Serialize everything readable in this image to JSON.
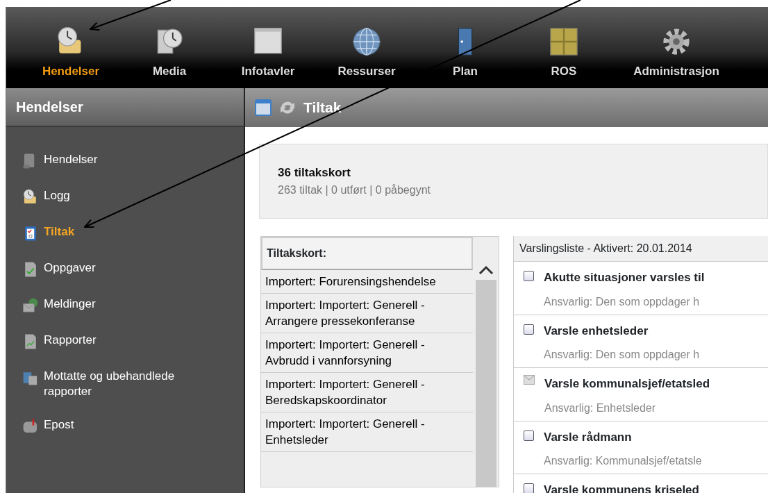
{
  "top_nav": [
    {
      "label": "Hendelser",
      "selected": true
    },
    {
      "label": "Media",
      "selected": false
    },
    {
      "label": "Infotavler",
      "selected": false
    },
    {
      "label": "Ressurser",
      "selected": false
    },
    {
      "label": "Plan",
      "selected": false
    },
    {
      "label": "ROS",
      "selected": false
    },
    {
      "label": "Administrasjon",
      "selected": false
    }
  ],
  "sidebar": {
    "title": "Hendelser",
    "items": [
      {
        "label": "Hendelser",
        "selected": false
      },
      {
        "label": "Logg",
        "selected": false
      },
      {
        "label": "Tiltak",
        "selected": true
      },
      {
        "label": "Oppgaver",
        "selected": false
      },
      {
        "label": "Meldinger",
        "selected": false
      },
      {
        "label": "Rapporter",
        "selected": false
      },
      {
        "label": "Mottatte og ubehandlede rapporter",
        "selected": false
      },
      {
        "label": "Epost",
        "selected": false
      }
    ]
  },
  "content": {
    "title": "Tiltak",
    "summary": {
      "heading": "36 tiltakskort",
      "detail": "263 tiltak | 0 utført | 0 påbegynt"
    },
    "cards": {
      "heading": "Tiltakskort:",
      "items": [
        "Importert: Forurensingshendelse",
        "Importert: Importert: Generell - Arrangere pressekonferanse",
        "Importert: Importert: Generell - Avbrudd i vannforsyning",
        "Importert: Importert: Generell - Beredskapskoordinator",
        "Importert: Importert: Generell - Enhetsleder"
      ]
    },
    "list": {
      "heading": "Varslingsliste - Aktivert: 20.01.2014",
      "items": [
        {
          "kind": "checkbox",
          "checked": false,
          "title": "Akutte situasjoner varsles til",
          "responsible": "Ansvarlig: Den som oppdager h"
        },
        {
          "kind": "checkbox",
          "checked": false,
          "title": "Varsle enhetsleder",
          "responsible": "Ansvarlig: Den som oppdager h"
        },
        {
          "kind": "message",
          "title": "Varsle kommunalsjef/etatsled",
          "responsible": "Ansvarlig: Enhetsleder"
        },
        {
          "kind": "checkbox",
          "checked": false,
          "title": "Varsle rådmann",
          "responsible": "Ansvarlig: Kommunalsjef/etatsle"
        },
        {
          "kind": "checkbox",
          "checked": false,
          "title": "Varsle kommunens kriseled"
        }
      ]
    }
  }
}
